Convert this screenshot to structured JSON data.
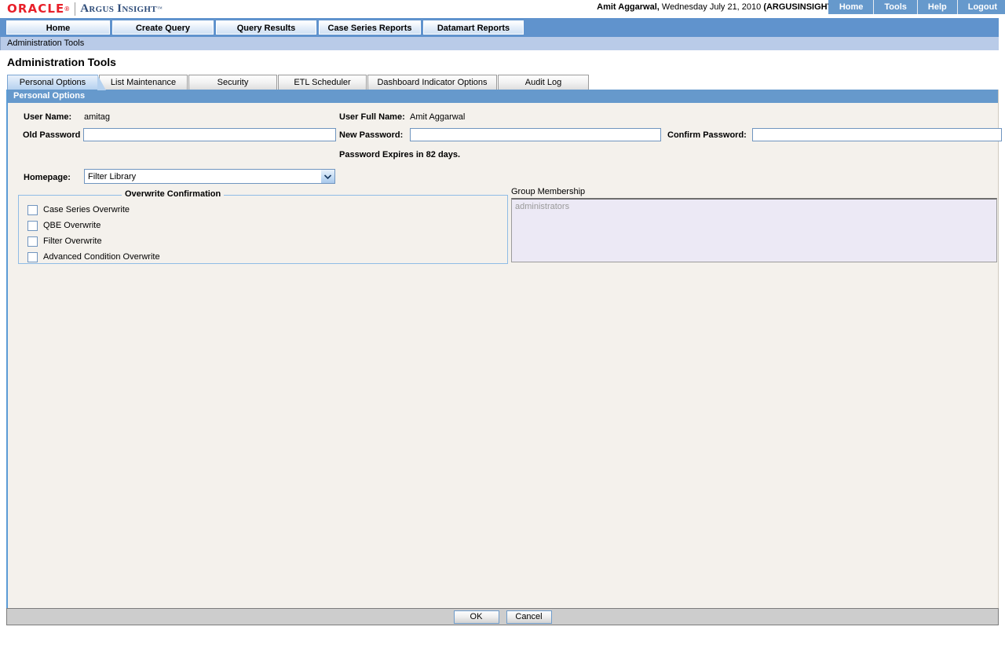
{
  "header": {
    "logo_oracle": "ORACLE",
    "logo_reg": "®",
    "logo_product": "Argus Insight",
    "logo_tm": "™",
    "user_name_bold": "Amit Aggarwal,",
    "user_session": " Wednesday July 21, 2010 ",
    "user_db": "(ARGUSINSIGHT)",
    "buttons": [
      {
        "label": "Home"
      },
      {
        "label": "Tools"
      },
      {
        "label": "Help"
      },
      {
        "label": "Logout"
      }
    ]
  },
  "main_nav": {
    "tabs": [
      {
        "label": "Home"
      },
      {
        "label": "Create Query"
      },
      {
        "label": "Query Results"
      },
      {
        "label": "Case Series Reports"
      },
      {
        "label": "Datamart Reports"
      }
    ]
  },
  "breadcrumb": {
    "text": "Administration Tools"
  },
  "page_title": "Administration Tools",
  "sub_tabs": [
    {
      "label": "Personal Options",
      "active": true
    },
    {
      "label": "List Maintenance",
      "active": false
    },
    {
      "label": "Security",
      "active": false
    },
    {
      "label": "ETL Scheduler",
      "active": false
    },
    {
      "label": "Dashboard Indicator Options",
      "active": false
    },
    {
      "label": "Audit Log",
      "active": false
    }
  ],
  "panel": {
    "header": "Personal Options",
    "user_name_label": "User Name:",
    "user_name_value": "amitag",
    "user_full_name_label": "User Full Name:",
    "user_full_name_value": "Amit Aggarwal",
    "old_password_label": "Old Password",
    "old_password_value": "",
    "new_password_label": "New Password:",
    "new_password_value": "",
    "confirm_password_label": "Confirm Password:",
    "confirm_password_value": "",
    "password_expiry_note": "Password Expires in 82 days.",
    "homepage_label": "Homepage:",
    "homepage_value": "Filter Library",
    "overwrite": {
      "legend": "Overwrite Confirmation",
      "items": [
        {
          "label": "Case Series Overwrite",
          "checked": false
        },
        {
          "label": "QBE Overwrite",
          "checked": false
        },
        {
          "label": "Filter Overwrite",
          "checked": false
        },
        {
          "label": "Advanced Condition Overwrite",
          "checked": false
        }
      ]
    },
    "group_membership": {
      "label": "Group Membership",
      "items": [
        "administrators"
      ]
    }
  },
  "footer": {
    "ok_label": "OK",
    "cancel_label": "Cancel"
  },
  "colors": {
    "oracle_red": "#e8202a",
    "argus_blue": "#2f4d7a",
    "nav_blue": "#6093cd",
    "panel_header_blue": "#6699cc",
    "breadcrumb_blue": "#b9cbe8",
    "content_bg": "#f4f1ec",
    "field_border": "#7095bf",
    "footer_grey": "#cdcdcd"
  }
}
